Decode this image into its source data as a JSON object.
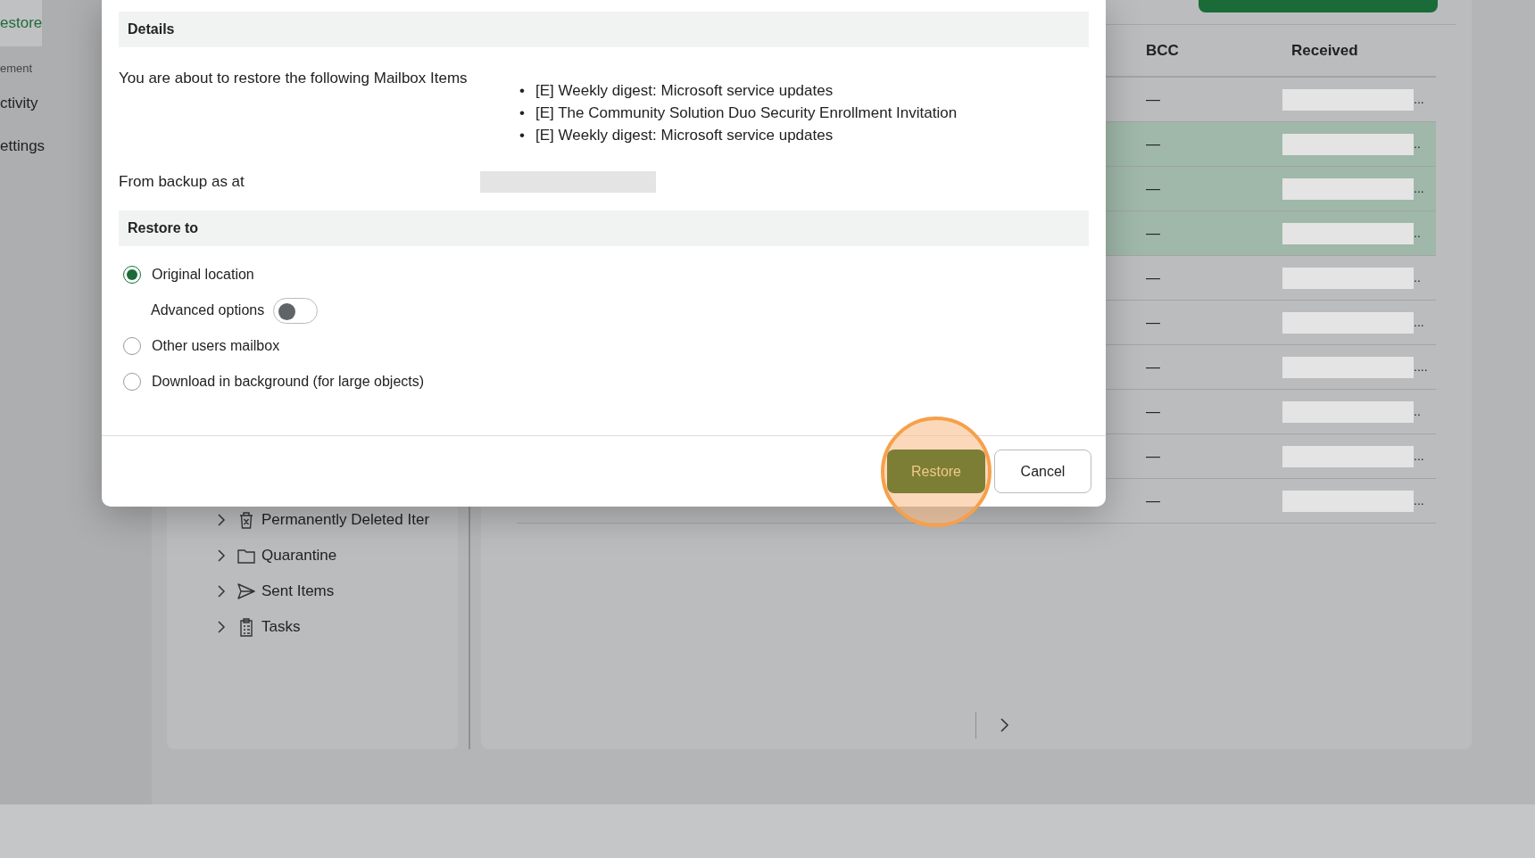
{
  "nav": [
    {
      "kind": "item",
      "label": "estore",
      "selected": true
    },
    {
      "kind": "section",
      "label": "ement"
    },
    {
      "kind": "item",
      "label": "ctivity",
      "selected": false
    },
    {
      "kind": "item",
      "label": "ettings",
      "selected": false
    }
  ],
  "folders": [
    {
      "kind": "trash",
      "label": "Permanently Deleted Iter"
    },
    {
      "kind": "folder",
      "label": "Quarantine"
    },
    {
      "kind": "send",
      "label": "Sent Items"
    },
    {
      "kind": "tasks",
      "label": "Tasks"
    }
  ],
  "table": {
    "columns": [
      "BCC",
      "Received"
    ],
    "rows": [
      {
        "bcc": "—",
        "received": "...",
        "selected": false
      },
      {
        "bcc": "—",
        "received": "..",
        "selected": true
      },
      {
        "bcc": "—",
        "received": "...",
        "selected": true
      },
      {
        "bcc": "—",
        "received": "..",
        "selected": true
      },
      {
        "bcc": "—",
        "received": "..",
        "selected": false
      },
      {
        "bcc": "—",
        "received": "...",
        "selected": false
      },
      {
        "bcc": "—",
        "received": "....",
        "selected": false
      },
      {
        "bcc": "—",
        "received": "..",
        "selected": false
      },
      {
        "bcc": "—",
        "received": "...",
        "selected": false
      },
      {
        "bcc": "—",
        "received": "...",
        "selected": false
      }
    ]
  },
  "dialog": {
    "details_heading": "Details",
    "intro": "You are about to restore the following Mailbox Items",
    "items": [
      {
        "marker": "•",
        "text": "[E] Weekly digest: Microsoft service updates"
      },
      {
        "marker": "•",
        "text": "[E] The Community Solution Duo Security Enrollment Invitation"
      },
      {
        "marker": "•",
        "text": "[E] Weekly digest: Microsoft service updates"
      }
    ],
    "backup_label": "From backup as at",
    "restore_heading": "Restore to",
    "options": [
      {
        "kind": "radio",
        "label": "Original location",
        "selected": true
      },
      {
        "kind": "toggle",
        "label": "Advanced options",
        "on": false
      },
      {
        "kind": "radio",
        "label": "Other users mailbox",
        "selected": false
      },
      {
        "kind": "radio",
        "label": "Download in background (for large objects)",
        "selected": false
      }
    ],
    "buttons": [
      {
        "kind": "primary",
        "label": "Restore",
        "highlighted": true
      },
      {
        "kind": "secondary",
        "label": "Cancel",
        "highlighted": false
      }
    ]
  }
}
